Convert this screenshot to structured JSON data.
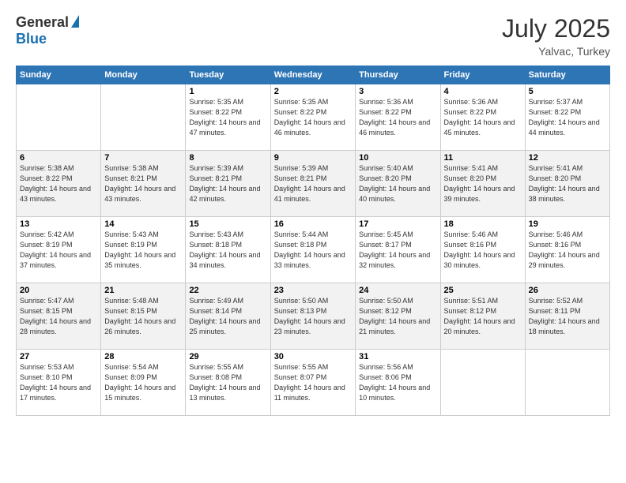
{
  "header": {
    "logo_general": "General",
    "logo_blue": "Blue",
    "month_year": "July 2025",
    "location": "Yalvac, Turkey"
  },
  "weekdays": [
    "Sunday",
    "Monday",
    "Tuesday",
    "Wednesday",
    "Thursday",
    "Friday",
    "Saturday"
  ],
  "weeks": [
    [
      {
        "day": "",
        "info": ""
      },
      {
        "day": "",
        "info": ""
      },
      {
        "day": "1",
        "info": "Sunrise: 5:35 AM\nSunset: 8:22 PM\nDaylight: 14 hours and 47 minutes."
      },
      {
        "day": "2",
        "info": "Sunrise: 5:35 AM\nSunset: 8:22 PM\nDaylight: 14 hours and 46 minutes."
      },
      {
        "day": "3",
        "info": "Sunrise: 5:36 AM\nSunset: 8:22 PM\nDaylight: 14 hours and 46 minutes."
      },
      {
        "day": "4",
        "info": "Sunrise: 5:36 AM\nSunset: 8:22 PM\nDaylight: 14 hours and 45 minutes."
      },
      {
        "day": "5",
        "info": "Sunrise: 5:37 AM\nSunset: 8:22 PM\nDaylight: 14 hours and 44 minutes."
      }
    ],
    [
      {
        "day": "6",
        "info": "Sunrise: 5:38 AM\nSunset: 8:22 PM\nDaylight: 14 hours and 43 minutes."
      },
      {
        "day": "7",
        "info": "Sunrise: 5:38 AM\nSunset: 8:21 PM\nDaylight: 14 hours and 43 minutes."
      },
      {
        "day": "8",
        "info": "Sunrise: 5:39 AM\nSunset: 8:21 PM\nDaylight: 14 hours and 42 minutes."
      },
      {
        "day": "9",
        "info": "Sunrise: 5:39 AM\nSunset: 8:21 PM\nDaylight: 14 hours and 41 minutes."
      },
      {
        "day": "10",
        "info": "Sunrise: 5:40 AM\nSunset: 8:20 PM\nDaylight: 14 hours and 40 minutes."
      },
      {
        "day": "11",
        "info": "Sunrise: 5:41 AM\nSunset: 8:20 PM\nDaylight: 14 hours and 39 minutes."
      },
      {
        "day": "12",
        "info": "Sunrise: 5:41 AM\nSunset: 8:20 PM\nDaylight: 14 hours and 38 minutes."
      }
    ],
    [
      {
        "day": "13",
        "info": "Sunrise: 5:42 AM\nSunset: 8:19 PM\nDaylight: 14 hours and 37 minutes."
      },
      {
        "day": "14",
        "info": "Sunrise: 5:43 AM\nSunset: 8:19 PM\nDaylight: 14 hours and 35 minutes."
      },
      {
        "day": "15",
        "info": "Sunrise: 5:43 AM\nSunset: 8:18 PM\nDaylight: 14 hours and 34 minutes."
      },
      {
        "day": "16",
        "info": "Sunrise: 5:44 AM\nSunset: 8:18 PM\nDaylight: 14 hours and 33 minutes."
      },
      {
        "day": "17",
        "info": "Sunrise: 5:45 AM\nSunset: 8:17 PM\nDaylight: 14 hours and 32 minutes."
      },
      {
        "day": "18",
        "info": "Sunrise: 5:46 AM\nSunset: 8:16 PM\nDaylight: 14 hours and 30 minutes."
      },
      {
        "day": "19",
        "info": "Sunrise: 5:46 AM\nSunset: 8:16 PM\nDaylight: 14 hours and 29 minutes."
      }
    ],
    [
      {
        "day": "20",
        "info": "Sunrise: 5:47 AM\nSunset: 8:15 PM\nDaylight: 14 hours and 28 minutes."
      },
      {
        "day": "21",
        "info": "Sunrise: 5:48 AM\nSunset: 8:15 PM\nDaylight: 14 hours and 26 minutes."
      },
      {
        "day": "22",
        "info": "Sunrise: 5:49 AM\nSunset: 8:14 PM\nDaylight: 14 hours and 25 minutes."
      },
      {
        "day": "23",
        "info": "Sunrise: 5:50 AM\nSunset: 8:13 PM\nDaylight: 14 hours and 23 minutes."
      },
      {
        "day": "24",
        "info": "Sunrise: 5:50 AM\nSunset: 8:12 PM\nDaylight: 14 hours and 21 minutes."
      },
      {
        "day": "25",
        "info": "Sunrise: 5:51 AM\nSunset: 8:12 PM\nDaylight: 14 hours and 20 minutes."
      },
      {
        "day": "26",
        "info": "Sunrise: 5:52 AM\nSunset: 8:11 PM\nDaylight: 14 hours and 18 minutes."
      }
    ],
    [
      {
        "day": "27",
        "info": "Sunrise: 5:53 AM\nSunset: 8:10 PM\nDaylight: 14 hours and 17 minutes."
      },
      {
        "day": "28",
        "info": "Sunrise: 5:54 AM\nSunset: 8:09 PM\nDaylight: 14 hours and 15 minutes."
      },
      {
        "day": "29",
        "info": "Sunrise: 5:55 AM\nSunset: 8:08 PM\nDaylight: 14 hours and 13 minutes."
      },
      {
        "day": "30",
        "info": "Sunrise: 5:55 AM\nSunset: 8:07 PM\nDaylight: 14 hours and 11 minutes."
      },
      {
        "day": "31",
        "info": "Sunrise: 5:56 AM\nSunset: 8:06 PM\nDaylight: 14 hours and 10 minutes."
      },
      {
        "day": "",
        "info": ""
      },
      {
        "day": "",
        "info": ""
      }
    ]
  ]
}
